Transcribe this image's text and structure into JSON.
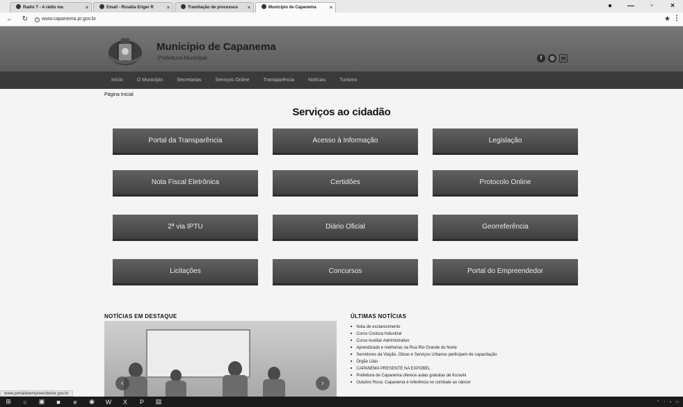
{
  "browser": {
    "tabs": [
      {
        "label": "Radio T - A rádio ma"
      },
      {
        "label": "Email - Rosália Eriger R"
      },
      {
        "label": "Tramitação de processos"
      },
      {
        "label": "Município de Capanema"
      }
    ],
    "url": "www.capanema.pr.gov.br",
    "status_url": "www.portaldoempreendedor.gov.br"
  },
  "site": {
    "title": "Município de Capanema",
    "subtitle": "Prefeitura Municipal",
    "nav": [
      "Início",
      "O Município",
      "Secretarias",
      "Serviços Online",
      "Transparência",
      "Notícias",
      "Turismo"
    ],
    "breadcrumb": "Página Inicial"
  },
  "services": {
    "title": "Serviços ao cidadão",
    "items": [
      "Portal da Transparência",
      "Acesso à Informação",
      "Legislação",
      "Nota Fiscal Eletrônica",
      "Certidões",
      "Protocolo Online",
      "2ª via IPTU",
      "Diário Oficial",
      "Georreferência",
      "Licitações",
      "Concursos",
      "Portal do Empreendedor"
    ]
  },
  "news": {
    "featured_title": "NOTÍCIAS EM DESTAQUE",
    "latest_title": "ÚLTIMAS NOTÍCIAS",
    "latest": [
      "Nota de esclarecimento",
      "Curso Costura Industrial",
      "Curso Auxiliar Administrativo",
      "Aprendizado e melhorias na Rua Rio Grande do Norte",
      "Servidores da Viação, Obras e Serviços Urbanos participam de capacitação",
      "Órgão Lilás",
      "CAPANEMA PRESENTE NA EXPOBEL",
      "Prefeitura de Capanema oferece aulas gratuitas de Kurashi",
      "Outubro Rosa: Capanema é referência no combate ao câncer"
    ]
  },
  "colors": {
    "header_bg": "#6a6a6a",
    "nav_bg": "#3a3a3a",
    "button_bg": "#505050",
    "page_bg": "#f4f4f4"
  }
}
